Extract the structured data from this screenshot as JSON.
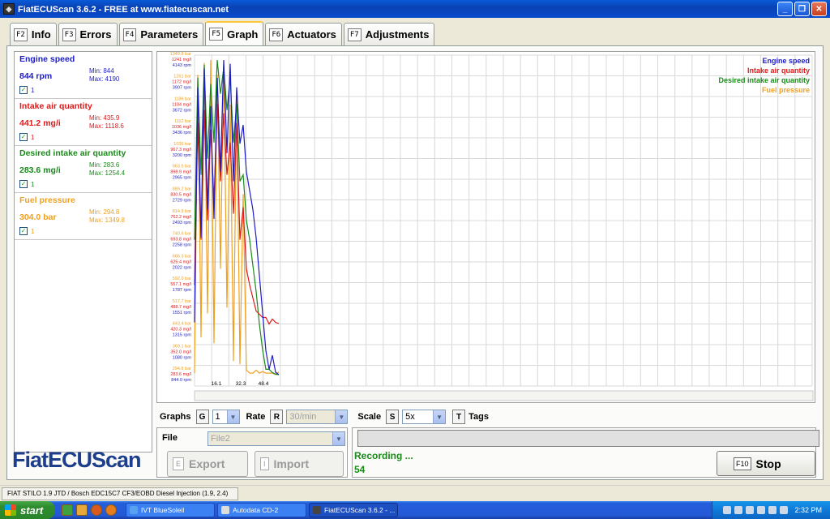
{
  "window": {
    "title": "FiatECUScan 3.6.2 - FREE at www.fiatecuscan.net"
  },
  "tabs": [
    {
      "key": "F2",
      "label": "Info"
    },
    {
      "key": "F3",
      "label": "Errors"
    },
    {
      "key": "F4",
      "label": "Parameters"
    },
    {
      "key": "F5",
      "label": "Graph"
    },
    {
      "key": "F6",
      "label": "Actuators"
    },
    {
      "key": "F7",
      "label": "Adjustments"
    }
  ],
  "parameters": [
    {
      "name": "Engine speed",
      "value": "844 rpm",
      "min": "Min: 844",
      "max": "Max: 4190",
      "tag": "1",
      "color": "#1c1cc8"
    },
    {
      "name": "Intake air quantity",
      "value": "441.2 mg/i",
      "min": "Min: 435.9",
      "max": "Max: 1118.6",
      "tag": "1",
      "color": "#e01a1a"
    },
    {
      "name": "Desired intake air quantity",
      "value": "283.6 mg/i",
      "min": "Min: 283.6",
      "max": "Max: 1254.4",
      "tag": "1",
      "color": "#1a8a1a"
    },
    {
      "name": "Fuel pressure",
      "value": "304.0 bar",
      "min": "Min: 294.8",
      "max": "Max: 1349.8",
      "tag": "1",
      "color": "#f0a020"
    }
  ],
  "logo": "FiatECUScan",
  "chart_data": {
    "type": "line",
    "title": "",
    "x_ticks": [
      "16.1",
      "32.3",
      "48.4"
    ],
    "legend": [
      "Engine speed",
      "Intake air quantity",
      "Desired intake air quantity",
      "Fuel pressure"
    ],
    "legend_placement": "top-right",
    "grid": true,
    "y_labels": [
      [
        "1349.8 bar",
        "1241 mg/l",
        "4143 rpm"
      ],
      [
        "1261 bar",
        "1172 mg/l",
        "3907 rpm"
      ],
      [
        "1186 bar",
        "1104 mg/l",
        "3672 rpm"
      ],
      [
        "1112 bar",
        "1036 mg/l",
        "3436 rpm"
      ],
      [
        "1036 bar",
        "967.3 mg/l",
        "3200 rpm"
      ],
      [
        "963.5 bar",
        "898.9 mg/l",
        "2965 rpm"
      ],
      [
        "889.2 bar",
        "830.5 mg/l",
        "2729 rpm"
      ],
      [
        "814.9 bar",
        "762.2 mg/l",
        "2493 rpm"
      ],
      [
        "740.6 bar",
        "693.8 mg/l",
        "2258 rpm"
      ],
      [
        "666.3 bar",
        "625.4 mg/l",
        "2022 rpm"
      ],
      [
        "592.0 bar",
        "557.1 mg/l",
        "1787 rpm"
      ],
      [
        "517.7 bar",
        "488.7 mg/l",
        "1551 rpm"
      ],
      [
        "443.4 bar",
        "420.3 mg/l",
        "1315 rpm"
      ],
      [
        "369.1 bar",
        "352.0 mg/l",
        "1080 rpm"
      ],
      [
        "294.8 bar",
        "283.6 mg/l",
        "844.0 rpm"
      ]
    ],
    "series": [
      {
        "name": "Engine speed",
        "color": "#1c1cc8",
        "x": [
          0,
          2,
          4,
          6,
          8,
          10,
          12,
          14,
          16,
          18,
          20,
          22,
          24,
          26,
          28,
          30,
          32,
          34,
          36,
          38,
          40,
          42,
          44,
          46,
          48,
          50,
          52
        ],
        "y": [
          1400,
          3900,
          2300,
          4100,
          2600,
          3700,
          2500,
          4000,
          3000,
          4190,
          3200,
          4150,
          2900,
          3900,
          3300,
          3500,
          3000,
          2800,
          2600,
          2300,
          1900,
          1500,
          1100,
          900,
          1050,
          870,
          844
        ]
      },
      {
        "name": "Intake air quantity",
        "color": "#e01a1a",
        "x": [
          0,
          2,
          4,
          6,
          8,
          10,
          12,
          14,
          16,
          18,
          20,
          22,
          24,
          26,
          28,
          30,
          32,
          34,
          36,
          38,
          40,
          42,
          44,
          46,
          48,
          50,
          52
        ],
        "y": [
          560,
          1060,
          700,
          1100,
          760,
          1040,
          820,
          1118.6,
          880,
          1090,
          900,
          1000,
          780,
          1060,
          700,
          800,
          610,
          560,
          520,
          480,
          470,
          460,
          460,
          440,
          455,
          445,
          441.2
        ]
      },
      {
        "name": "Desired intake air quantity",
        "color": "#1a8a1a",
        "x": [
          0,
          2,
          4,
          6,
          8,
          10,
          12,
          14,
          16,
          18,
          20,
          22,
          24,
          26,
          28,
          30,
          32,
          34,
          36,
          38,
          40,
          42,
          44,
          46,
          48,
          50,
          52
        ],
        "y": [
          700,
          1200,
          900,
          1240,
          950,
          1180,
          1000,
          1254.4,
          1150,
          1230,
          1100,
          1200,
          1000,
          1120,
          880,
          900,
          760,
          700,
          620,
          540,
          440,
          360,
          300,
          300,
          290,
          285,
          283.6
        ]
      },
      {
        "name": "Fuel pressure",
        "color": "#f0a020",
        "x": [
          0,
          2,
          4,
          6,
          8,
          10,
          12,
          14,
          16,
          18,
          20,
          22,
          24,
          26,
          28,
          30,
          32,
          34,
          36,
          38,
          40,
          42,
          44,
          46,
          48,
          50,
          52
        ],
        "y": [
          300,
          1300,
          420,
          1340,
          500,
          1349.8,
          400,
          1300,
          650,
          1330,
          520,
          1200,
          340,
          1240,
          330,
          900,
          310,
          300,
          300,
          310,
          300,
          305,
          300,
          300,
          300,
          295,
          304.0
        ]
      }
    ]
  },
  "controls": {
    "graphs_label": "Graphs",
    "graphs_key": "G",
    "graphs_value": "1",
    "rate_label": "Rate",
    "rate_key": "R",
    "rate_value": "30/min",
    "scale_label": "Scale",
    "scale_key": "S",
    "scale_value": "5x",
    "tags_key": "T",
    "tags_label": "Tags"
  },
  "file": {
    "label": "File",
    "value": "File2",
    "export_key": "E",
    "export_label": "Export",
    "import_key": "I",
    "import_label": "Import"
  },
  "status": {
    "recording": "Recording ...",
    "count": "54",
    "stop_key": "F10",
    "stop_label": "Stop"
  },
  "statusbar": {
    "vehicle": "FIAT STILO 1.9 JTD / Bosch EDC15C7 CF3/EOBD Diesel Injection (1.9, 2.4)"
  },
  "taskbar": {
    "start": "start",
    "tasks": [
      "IVT BlueSoleil",
      "Autodata CD-2",
      "FiatECUScan 3.6.2 - ..."
    ],
    "clock": "2:32 PM"
  }
}
